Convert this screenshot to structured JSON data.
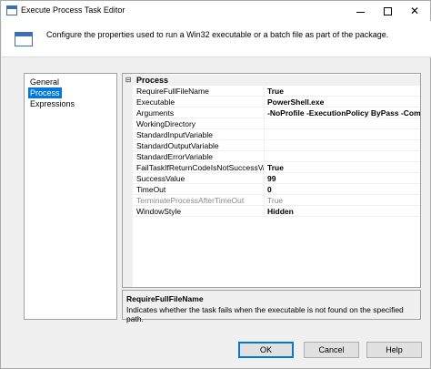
{
  "window": {
    "title": "Execute Process Task Editor",
    "minimize_glyph": "",
    "maximize_glyph": "",
    "close_glyph": "✕"
  },
  "header": {
    "description": "Configure the properties used to run a Win32 executable or a batch file as part of the package."
  },
  "nav": {
    "items": [
      {
        "label": "General",
        "selected": false
      },
      {
        "label": "Process",
        "selected": true
      },
      {
        "label": "Expressions",
        "selected": false
      }
    ]
  },
  "grid": {
    "category": {
      "toggle": "⊟",
      "label": "Process"
    },
    "properties": [
      {
        "name": "RequireFullFileName",
        "value": "True",
        "bold": true,
        "disabled": false
      },
      {
        "name": "Executable",
        "value": "PowerShell.exe",
        "bold": true,
        "disabled": false
      },
      {
        "name": "Arguments",
        "value": "-NoProfile -ExecutionPolicy ByPass -Command (",
        "bold": true,
        "disabled": false
      },
      {
        "name": "WorkingDirectory",
        "value": "",
        "bold": false,
        "disabled": false
      },
      {
        "name": "StandardInputVariable",
        "value": "",
        "bold": false,
        "disabled": false
      },
      {
        "name": "StandardOutputVariable",
        "value": "",
        "bold": false,
        "disabled": false
      },
      {
        "name": "StandardErrorVariable",
        "value": "",
        "bold": false,
        "disabled": false
      },
      {
        "name": "FailTaskIfReturnCodeIsNotSuccessValue",
        "value": "True",
        "bold": true,
        "disabled": false
      },
      {
        "name": "SuccessValue",
        "value": "99",
        "bold": true,
        "disabled": false
      },
      {
        "name": "TimeOut",
        "value": "0",
        "bold": true,
        "disabled": false
      },
      {
        "name": "TerminateProcessAfterTimeOut",
        "value": "True",
        "bold": false,
        "disabled": true
      },
      {
        "name": "WindowStyle",
        "value": "Hidden",
        "bold": true,
        "disabled": false
      }
    ]
  },
  "description_panel": {
    "title": "RequireFullFileName",
    "text": "Indicates whether the task fails when the executable is not found on the specified path."
  },
  "buttons": {
    "ok": "OK",
    "cancel": "Cancel",
    "help": "Help"
  },
  "colors": {
    "selection": "#0078d7",
    "accent_icon": "#3c6fb0"
  }
}
